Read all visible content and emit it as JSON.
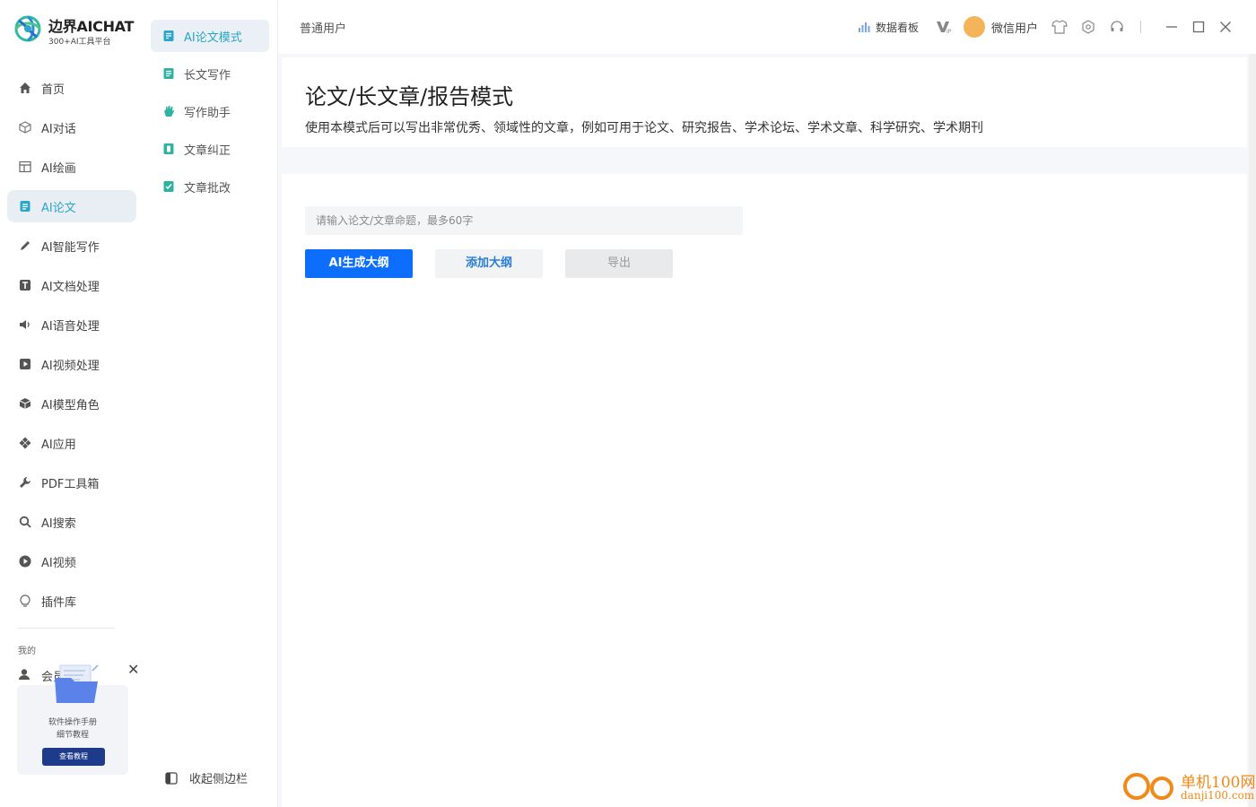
{
  "brand": {
    "name": "边界AICHAT",
    "tagline": "300+AI工具平台"
  },
  "sidebar": {
    "items": [
      {
        "label": "首页",
        "icon": "home-icon"
      },
      {
        "label": "AI对话",
        "icon": "cube-chat-icon"
      },
      {
        "label": "AI绘画",
        "icon": "canvas-icon"
      },
      {
        "label": "AI论文",
        "icon": "document-icon",
        "active": true
      },
      {
        "label": "AI智能写作",
        "icon": "pen-icon"
      },
      {
        "label": "AI文档处理",
        "icon": "text-doc-icon"
      },
      {
        "label": "AI语音处理",
        "icon": "speaker-icon"
      },
      {
        "label": "AI视频处理",
        "icon": "video-icon"
      },
      {
        "label": "AI模型角色",
        "icon": "cube-icon"
      },
      {
        "label": "AI应用",
        "icon": "apps-icon"
      },
      {
        "label": "PDF工具箱",
        "icon": "wrench-icon"
      },
      {
        "label": "AI搜索",
        "icon": "search-icon"
      },
      {
        "label": "AI视频",
        "icon": "play-icon"
      },
      {
        "label": "插件库",
        "icon": "bulb-icon"
      }
    ],
    "mine_label": "我的",
    "member_label": "会员中心"
  },
  "promo": {
    "line1": "软件操作手册",
    "line2": "细节教程",
    "button": "查看教程"
  },
  "subnav": {
    "items": [
      {
        "label": "AI论文模式",
        "active": true
      },
      {
        "label": "长文写作"
      },
      {
        "label": "写作助手"
      },
      {
        "label": "文章纠正"
      },
      {
        "label": "文章批改"
      }
    ],
    "collapse_label": "收起侧边栏"
  },
  "topbar": {
    "user_type": "普通用户",
    "dashboard_label": "数据看板",
    "username": "微信用户",
    "colors": {
      "avatar": "#f5b45a",
      "accent": "#2aa6c8"
    }
  },
  "main": {
    "title": "论文/长文章/报告模式",
    "description": "使用本模式后可以写出非常优秀、领域性的文章，例如可用于论文、研究报告、学术论坛、学术文章、科学研究、学术期刊",
    "input_placeholder": "请输入论文/文章命题，最多60字",
    "buttons": {
      "generate": "AI生成大纲",
      "add": "添加大纲",
      "export": "导出"
    },
    "colors": {
      "primary_button": "#0d6efd"
    }
  },
  "watermark": {
    "name": "单机100网",
    "url": "danji100.com"
  }
}
